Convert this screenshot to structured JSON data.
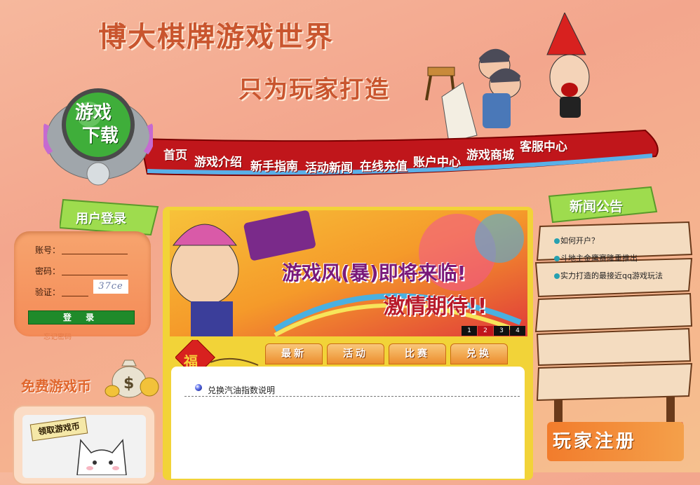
{
  "header": {
    "title": "博大棋牌游戏世界",
    "slogan": "只为玩家打造"
  },
  "download": {
    "label_top": "游戏",
    "label_bottom": "下载"
  },
  "nav": {
    "items": [
      "首页",
      "游戏介绍",
      "新手指南",
      "活动新闻",
      "在线充值",
      "账户中心",
      "游戏商城",
      "客服中心"
    ]
  },
  "login": {
    "title": "用户登录",
    "account_label": "账号：",
    "password_label": "密码：",
    "verify_label": "验证：",
    "captcha": "37ce",
    "button": "登 录",
    "forgot": "忘记密码"
  },
  "coins": {
    "title": "免费游戏币",
    "tag": "领取游戏币"
  },
  "banner": {
    "line1": "游戏风(暴)即将来临!",
    "line2": "激情期待!!",
    "pages": [
      "1",
      "2",
      "3",
      "4"
    ]
  },
  "tabs": [
    "最新",
    "活动",
    "比赛",
    "兑换"
  ],
  "fu_badge": {
    "char": "福"
  },
  "news": {
    "items": [
      "兑换汽油指数说明"
    ]
  },
  "notice": {
    "title": "新闻公告",
    "items": [
      "如何开户？",
      "斗地主金鹰赛隆重推出",
      "实力打造的最接近qq游戏玩法"
    ]
  },
  "register": {
    "label": "玩家注册"
  },
  "colors": {
    "nav_red": "#c0161b",
    "accent_orange": "#f48b57",
    "login_green": "#1f8a2a",
    "tab_orange": "#ec8e2e"
  }
}
